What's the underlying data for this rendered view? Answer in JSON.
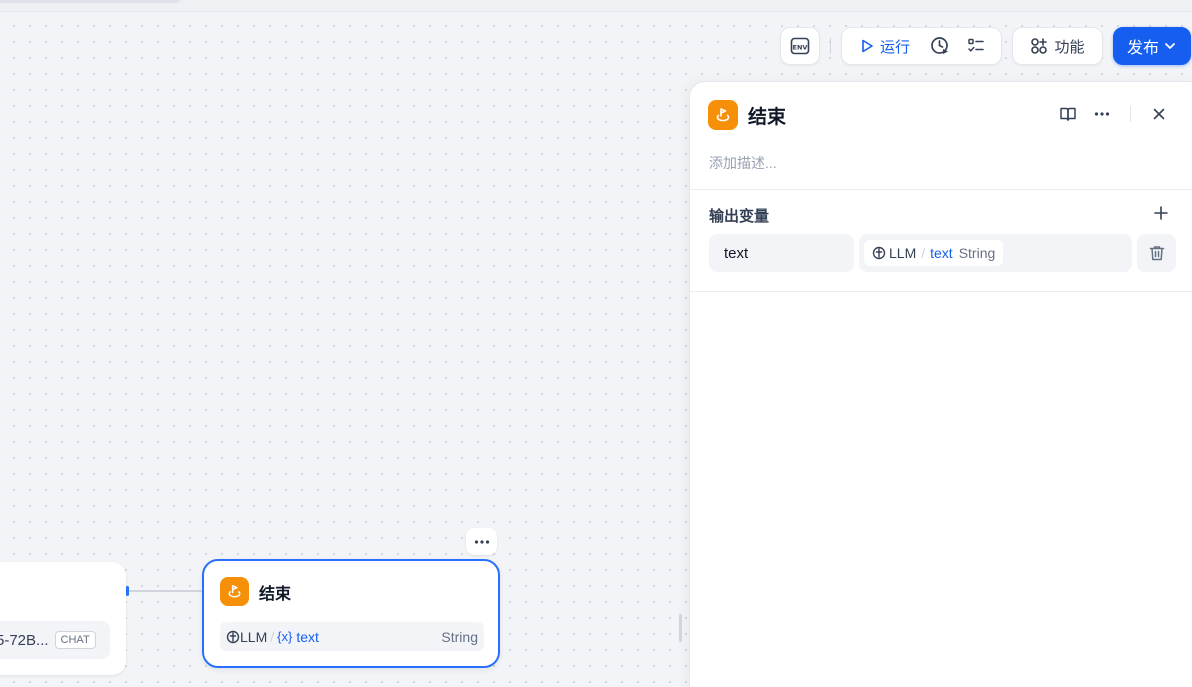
{
  "toolbar": {
    "env_label": "ENV",
    "run_label": "运行",
    "features_label": "功能",
    "publish_label": "发布"
  },
  "panel": {
    "title": "结束",
    "description_placeholder": "添加描述...",
    "section_title": "输出变量",
    "output": {
      "name": "text",
      "source_node": "LLM",
      "separator": "/",
      "variable": "text",
      "type": "String"
    }
  },
  "canvas": {
    "left_node": {
      "model_text": "5-72B...",
      "badge": "CHAT"
    },
    "end_node": {
      "title": "结束",
      "source_node": "LLM",
      "separator": "/",
      "var_prefix": "{x}",
      "variable": "text",
      "type": "String"
    }
  },
  "colors": {
    "accent": "#155eef",
    "node_border": "#2970ff",
    "end_icon": "#f79009"
  }
}
